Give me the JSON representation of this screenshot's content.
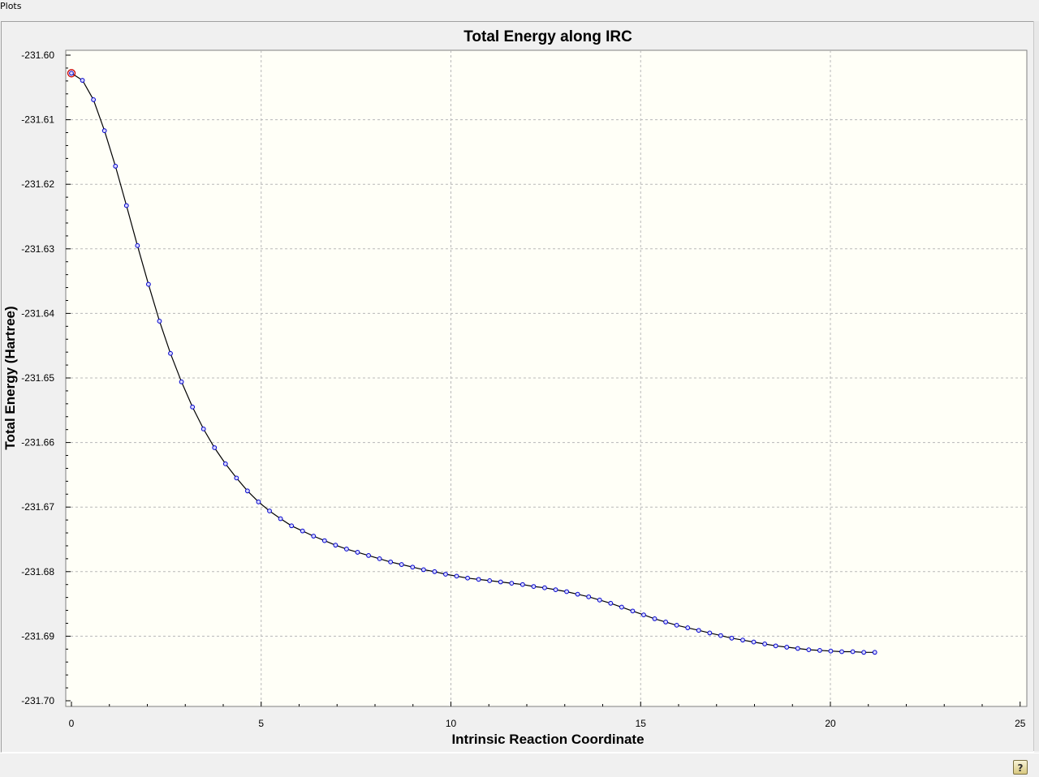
{
  "window": {
    "title": "Plots"
  },
  "help_icon_glyph": "?",
  "colors": {
    "plot_background": "#fffff7",
    "grid": "#b8b8b8",
    "line": "#000000",
    "marker_stroke": "#0000cc",
    "marker_fill": "#d8d8ff",
    "highlight_marker": "#cc0000"
  },
  "chart_data": {
    "type": "line",
    "title": "Total Energy along IRC",
    "xlabel": "Intrinsic Reaction Coordinate",
    "ylabel": "Total Energy (Hartree)",
    "xlim": [
      0,
      25
    ],
    "ylim": [
      -231.7,
      -231.6
    ],
    "xticks": [
      0,
      5,
      10,
      15,
      20,
      25
    ],
    "xtick_labels": [
      "0",
      "5",
      "10",
      "15",
      "20",
      "25"
    ],
    "yticks": [
      -231.6,
      -231.61,
      -231.62,
      -231.63,
      -231.64,
      -231.65,
      -231.66,
      -231.67,
      -231.68,
      -231.69,
      -231.7
    ],
    "ytick_labels": [
      "-231.60",
      "-231.61",
      "-231.62",
      "-231.63",
      "-231.64",
      "-231.65",
      "-231.66",
      "-231.67",
      "-231.68",
      "-231.69",
      "-231.70"
    ],
    "grid": true,
    "highlighted_point_index": 0,
    "series": [
      {
        "x": [
          0,
          0.29,
          0.58,
          0.87,
          1.16,
          1.45,
          1.74,
          2.03,
          2.32,
          2.61,
          2.9,
          3.19,
          3.48,
          3.77,
          4.06,
          4.35,
          4.64,
          4.93,
          5.22,
          5.51,
          5.8,
          6.09,
          6.38,
          6.67,
          6.96,
          7.25,
          7.54,
          7.83,
          8.12,
          8.41,
          8.7,
          8.99,
          9.28,
          9.57,
          9.86,
          10.15,
          10.44,
          10.73,
          11.02,
          11.31,
          11.6,
          11.89,
          12.18,
          12.47,
          12.76,
          13.05,
          13.34,
          13.63,
          13.92,
          14.21,
          14.5,
          14.79,
          15.08,
          15.37,
          15.66,
          15.95,
          16.24,
          16.53,
          16.82,
          17.11,
          17.4,
          17.69,
          17.98,
          18.27,
          18.56,
          18.85,
          19.14,
          19.43,
          19.72,
          20.01,
          20.3,
          20.59,
          20.88,
          21.17
        ],
        "y": [
          -231.6028,
          -231.6039,
          -231.6069,
          -231.6117,
          -231.6172,
          -231.6233,
          -231.6295,
          -231.6355,
          -231.6412,
          -231.6462,
          -231.6506,
          -231.6545,
          -231.6579,
          -231.6608,
          -231.6633,
          -231.6655,
          -231.6675,
          -231.6692,
          -231.6706,
          -231.6718,
          -231.6729,
          -231.6737,
          -231.6745,
          -231.6752,
          -231.6759,
          -231.6765,
          -231.677,
          -231.6775,
          -231.678,
          -231.6785,
          -231.6789,
          -231.6793,
          -231.6797,
          -231.68,
          -231.6804,
          -231.6807,
          -231.681,
          -231.6812,
          -231.6814,
          -231.6816,
          -231.6818,
          -231.682,
          -231.6823,
          -231.6825,
          -231.6828,
          -231.6831,
          -231.6835,
          -231.6839,
          -231.6844,
          -231.6849,
          -231.6855,
          -231.6861,
          -231.6867,
          -231.6873,
          -231.6878,
          -231.6883,
          -231.6887,
          -231.6891,
          -231.6895,
          -231.6899,
          -231.6903,
          -231.6906,
          -231.6909,
          -231.6912,
          -231.6915,
          -231.6917,
          -231.6919,
          -231.6921,
          -231.6922,
          -231.6923,
          -231.6924,
          -231.6924,
          -231.6925,
          -231.6925
        ]
      }
    ]
  }
}
